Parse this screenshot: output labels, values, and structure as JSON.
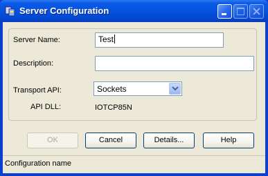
{
  "window": {
    "title": "Server Configuration"
  },
  "form": {
    "server_name_label": "Server Name:",
    "server_name_value": "Test",
    "description_label": "Description:",
    "description_value": "",
    "transport_label": "Transport API:",
    "transport_value": "Sockets",
    "api_dll_label": "API DLL:",
    "api_dll_value": "IOTCP85N"
  },
  "buttons": {
    "ok": "OK",
    "cancel": "Cancel",
    "details": "Details...",
    "help": "Help"
  },
  "statusbar": {
    "text": "Configuration name"
  },
  "colors": {
    "titlebar": "#0550dc",
    "face": "#ece9d8",
    "input_border": "#7f9db9"
  }
}
